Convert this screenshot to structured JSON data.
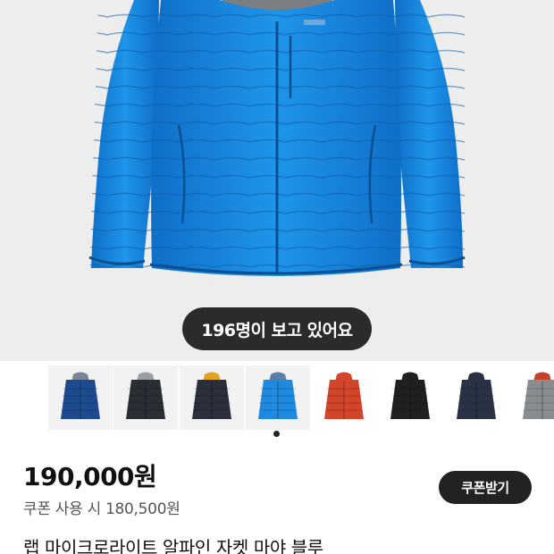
{
  "hero": {
    "image_alt": "blue down jacket product photo",
    "viewers_badge": "196명이 보고 있어요"
  },
  "thumbnails": [
    {
      "name": "navy",
      "body": "#1e4b8f",
      "hood": "#7a8596",
      "white_bg": false
    },
    {
      "name": "black",
      "body": "#2a2d33",
      "hood": "#9a9ea5",
      "white_bg": false
    },
    {
      "name": "black-orange",
      "body": "#2a2f3b",
      "hood": "#e2a320",
      "white_bg": false
    },
    {
      "name": "blue",
      "body": "#1f8be0",
      "hood": "#5b7fa6",
      "white_bg": false,
      "selected": true
    },
    {
      "name": "red",
      "body": "#d2452a",
      "hood": "#d2452a",
      "white_bg": true
    },
    {
      "name": "black-hood",
      "body": "#1f2022",
      "hood": "#1f2022",
      "white_bg": true
    },
    {
      "name": "navy-hood",
      "body": "#2a3346",
      "hood": "#2a3346",
      "white_bg": true
    },
    {
      "name": "grey",
      "body": "#8a8d90",
      "hood": "#c8402a",
      "white_bg": true
    }
  ],
  "pagination_active_index": 0,
  "product": {
    "price": "190,000원",
    "coupon_price_text": "쿠폰 사용 시 180,500원",
    "coupon_button": "쿠폰받기",
    "title": "랩 마이크로라이트 알파인 자켓 마야 블루"
  },
  "colors": {
    "jacket_blue": "#1a8ae0",
    "background": "#ededed",
    "dark": "#222222"
  }
}
